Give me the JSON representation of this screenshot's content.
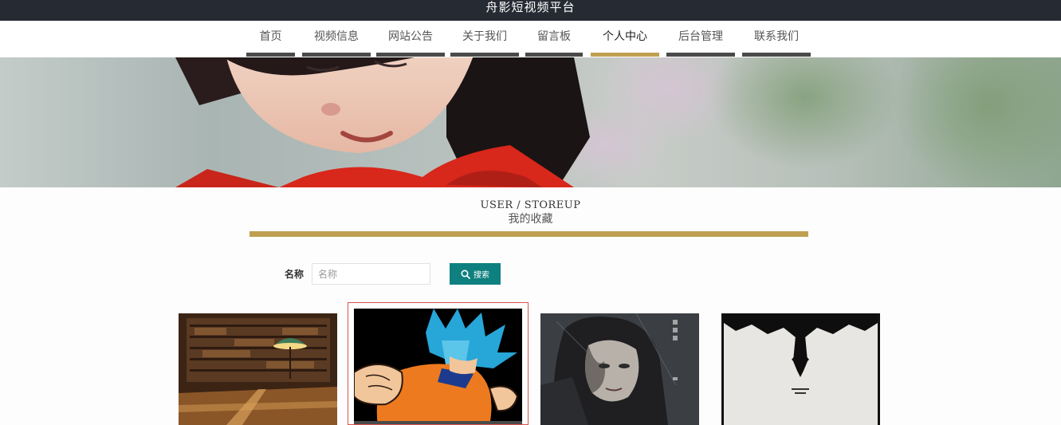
{
  "header": {
    "site_title": "舟影短视频平台"
  },
  "nav": {
    "items": [
      {
        "label": "首页"
      },
      {
        "label": "视频信息"
      },
      {
        "label": "网站公告"
      },
      {
        "label": "关于我们"
      },
      {
        "label": "留言板"
      },
      {
        "label": "个人中心",
        "active": true
      },
      {
        "label": "后台管理"
      },
      {
        "label": "联系我们"
      }
    ],
    "active_color": "#bfa052",
    "bar_color": "#4a4a4a"
  },
  "section": {
    "title_en": "USER / STOREUP",
    "title_cn": "我的收藏"
  },
  "search": {
    "label": "名称",
    "placeholder": "名称",
    "value": "",
    "button_label": "搜索"
  },
  "favorites": [
    {
      "image": "library-reading-room"
    },
    {
      "image": "anime-fighter-blue-hair",
      "selected": true
    },
    {
      "image": "dark-portrait-poster"
    },
    {
      "image": "bat-silhouette-poster"
    }
  ],
  "colors": {
    "topbar": "#262a33",
    "accent": "#bfa052",
    "button": "#0f8080"
  }
}
